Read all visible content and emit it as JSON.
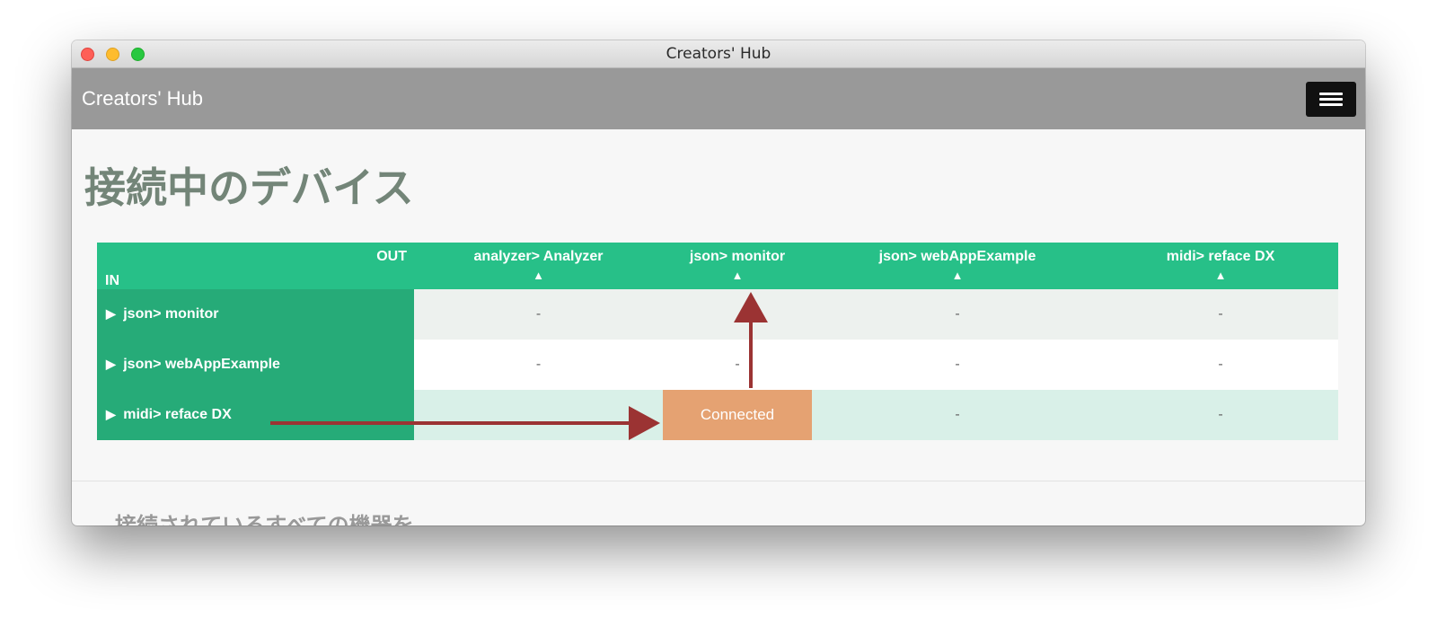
{
  "window": {
    "title": "Creators' Hub"
  },
  "navbar": {
    "brand": "Creators' Hub",
    "menu_icon": "hamburger-menu-icon"
  },
  "page": {
    "title": "接続中のデバイス",
    "next_section_title": "接続されているすべての機器を"
  },
  "matrix": {
    "corner_out": "OUT",
    "corner_in": "IN",
    "columns": [
      {
        "label": "analyzer> Analyzer",
        "arrow": "▲"
      },
      {
        "label": "json> monitor",
        "arrow": "▲"
      },
      {
        "label": "json> webAppExample",
        "arrow": "▲"
      },
      {
        "label": "midi> reface DX",
        "arrow": "▲"
      }
    ],
    "rows": [
      {
        "marker": "▶",
        "label": "json> monitor",
        "cells": [
          "-",
          "",
          "-",
          "-"
        ]
      },
      {
        "marker": "▶",
        "label": "json> webAppExample",
        "cells": [
          "-",
          "-",
          "-",
          "-"
        ]
      },
      {
        "marker": "▶",
        "label": "midi> reface DX",
        "cells": [
          "",
          "Connected",
          "-",
          "-"
        ]
      }
    ]
  },
  "colors": {
    "header_green": "#27c088",
    "row_header_green": "#26ab78",
    "connected": "#e5a272",
    "annotation_arrow": "#9b3333"
  }
}
